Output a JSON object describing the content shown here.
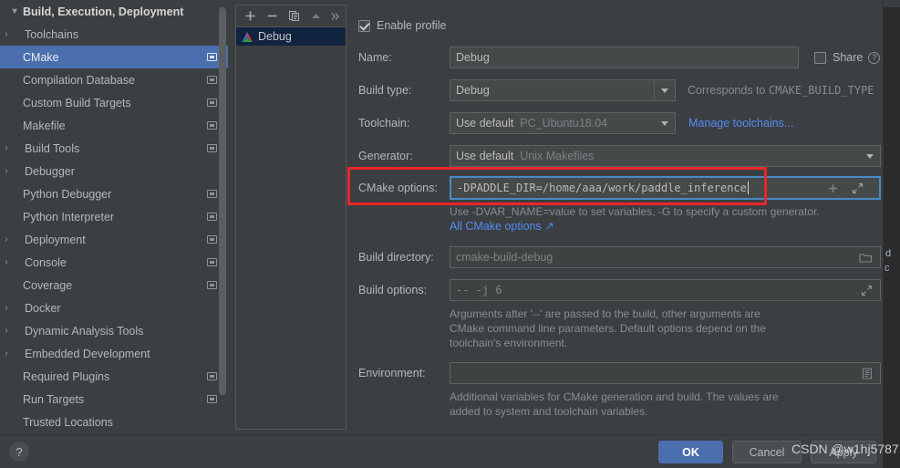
{
  "colors": {
    "accent_blue": "#4b6eaf",
    "link_blue": "#548af7",
    "focus_border": "#4a88c7",
    "annotation_red": "#e8262a",
    "dialog_bg": "#3c3f41",
    "field_bg": "#45494a",
    "selected_profile_bg": "#10233f"
  },
  "settings_tree": {
    "title": "Build, Execution, Deployment",
    "title_chevron": "chevron-down",
    "items": [
      {
        "label": "Toolchains",
        "chevron": "right",
        "badge": false,
        "selected": false
      },
      {
        "label": "CMake",
        "chevron": "none",
        "badge": true,
        "selected": true
      },
      {
        "label": "Compilation Database",
        "chevron": "none",
        "badge": true,
        "selected": false
      },
      {
        "label": "Custom Build Targets",
        "chevron": "none",
        "badge": true,
        "selected": false
      },
      {
        "label": "Makefile",
        "chevron": "none",
        "badge": true,
        "selected": false
      },
      {
        "label": "Build Tools",
        "chevron": "right",
        "badge": true,
        "selected": false
      },
      {
        "label": "Debugger",
        "chevron": "right",
        "badge": false,
        "selected": false
      },
      {
        "label": "Python Debugger",
        "chevron": "none",
        "badge": true,
        "selected": false
      },
      {
        "label": "Python Interpreter",
        "chevron": "none",
        "badge": true,
        "selected": false
      },
      {
        "label": "Deployment",
        "chevron": "right",
        "badge": true,
        "selected": false
      },
      {
        "label": "Console",
        "chevron": "right",
        "badge": true,
        "selected": false
      },
      {
        "label": "Coverage",
        "chevron": "none",
        "badge": true,
        "selected": false
      },
      {
        "label": "Docker",
        "chevron": "right",
        "badge": false,
        "selected": false
      },
      {
        "label": "Dynamic Analysis Tools",
        "chevron": "right",
        "badge": false,
        "selected": false
      },
      {
        "label": "Embedded Development",
        "chevron": "right",
        "badge": false,
        "selected": false
      },
      {
        "label": "Required Plugins",
        "chevron": "none",
        "badge": true,
        "selected": false
      },
      {
        "label": "Run Targets",
        "chevron": "none",
        "badge": true,
        "selected": false
      },
      {
        "label": "Trusted Locations",
        "chevron": "none",
        "badge": false,
        "selected": false
      }
    ]
  },
  "profiles_panel": {
    "toolbar": [
      {
        "name": "add-profile-button",
        "glyph": "+"
      },
      {
        "name": "remove-profile-button",
        "glyph": "−"
      },
      {
        "name": "copy-profile-button",
        "glyph": "copy"
      },
      {
        "name": "move-up-button",
        "glyph": "up-triangle"
      },
      {
        "name": "more-options-button",
        "glyph": "»"
      }
    ],
    "items": [
      {
        "label": "Debug",
        "icon": "cmake-logo-icon",
        "selected": true
      }
    ]
  },
  "form": {
    "enable_profile": {
      "label": "Enable profile",
      "checked": true
    },
    "name": {
      "label": "Name:",
      "value": "Debug"
    },
    "share": {
      "label": "Share",
      "checked": false,
      "help": "?"
    },
    "build_type": {
      "label": "Build type:",
      "value": "Debug",
      "note_prefix": "Corresponds to ",
      "note_mono": "CMAKE_BUILD_TYPE"
    },
    "toolchain": {
      "label": "Toolchain:",
      "value": "Use default",
      "value_secondary": "PC_Ubuntu18.04",
      "manage_link": "Manage toolchains..."
    },
    "generator": {
      "label": "Generator:",
      "value": "Use default",
      "value_secondary": "Unix Makefiles"
    },
    "cmake_options": {
      "label": "CMake options:",
      "value": "-DPADDLE_DIR=/home/aaa/work/paddle_inference",
      "focused": true,
      "hint_line1": "Use -DVAR_NAME=value to set variables, -G to specify a custom generator.",
      "hint_link": "All CMake options ↗",
      "add_icon": "plus-icon",
      "expand_icon": "expand-icon"
    },
    "build_directory": {
      "label": "Build directory:",
      "placeholder": "cmake-build-debug",
      "browse_icon": "folder-icon"
    },
    "build_options": {
      "label": "Build options:",
      "placeholder": "-- -j 6",
      "expand_icon": "expand-icon",
      "hint_line1": "Arguments after '--' are passed to the build, other arguments are",
      "hint_line2": "CMake command line parameters. Default options depend on the",
      "hint_line3": "toolchain's environment."
    },
    "environment": {
      "label": "Environment:",
      "value": "",
      "editor_icon": "list-editor-icon",
      "hint_line1": "Additional variables for CMake generation and build. The values are",
      "hint_line2": "added to system and toolchain variables."
    }
  },
  "bottom_bar": {
    "help_button": "?",
    "buttons": [
      {
        "name": "ok-button",
        "label": "OK",
        "style": "primary"
      },
      {
        "name": "cancel-button",
        "label": "Cancel",
        "style": "normal"
      },
      {
        "name": "apply-button",
        "label": "Apply",
        "style": "normal"
      }
    ]
  },
  "watermark": {
    "text": "CSDN @w1hj5787"
  },
  "background_ide": {
    "fragment_1": "d",
    "fragment_2": "c"
  }
}
